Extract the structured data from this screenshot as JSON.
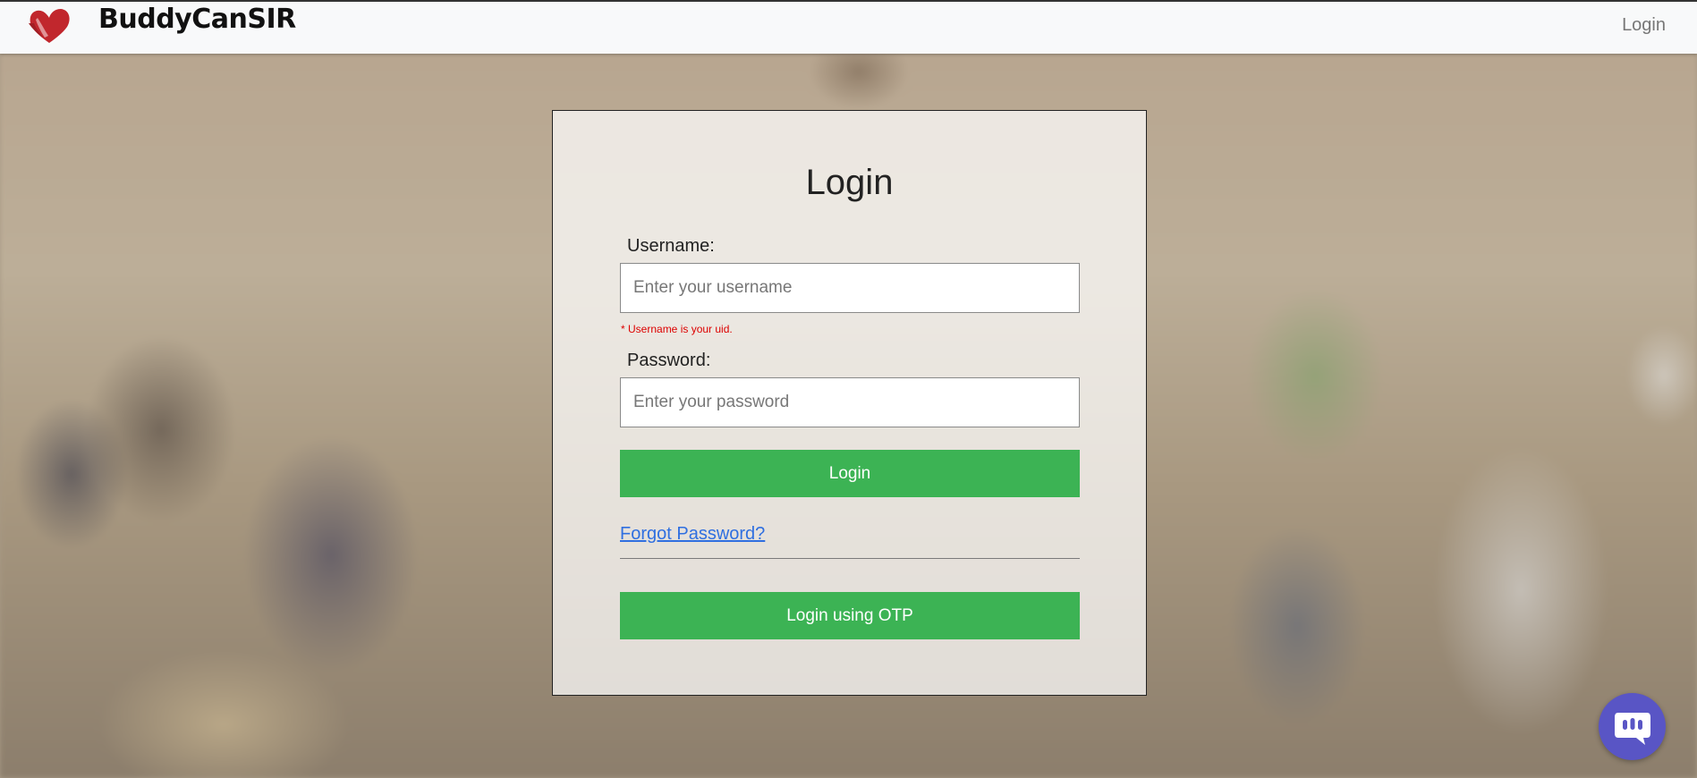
{
  "navbar": {
    "brand": "BuddyCanSIR",
    "login_link": "Login",
    "brand_logo_icon": "heart-hands-icon",
    "brand_color": "#c1272d"
  },
  "login_form": {
    "title": "Login",
    "username_label": "Username:",
    "username_placeholder": "Enter your username",
    "username_value": "",
    "username_hint": "* Username is your uid.",
    "password_label": "Password:",
    "password_placeholder": "Enter your password",
    "password_value": "",
    "login_button": "Login",
    "forgot_password": "Forgot Password?",
    "otp_button": "Login using OTP",
    "button_color": "#3cb354",
    "link_color": "#2f6fe0"
  },
  "chat_widget": {
    "icon": "chat-bubble-icon",
    "color": "#5955c5"
  }
}
